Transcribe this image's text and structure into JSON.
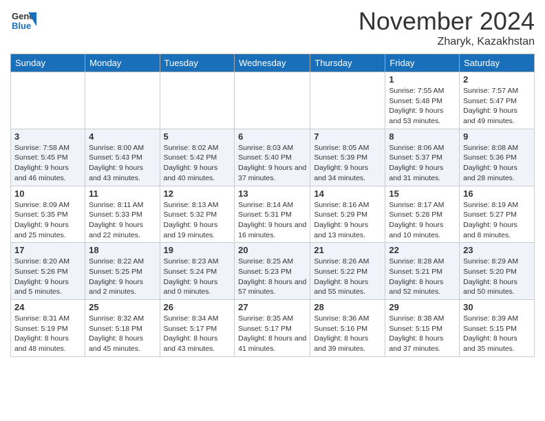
{
  "header": {
    "logo_general": "General",
    "logo_blue": "Blue",
    "month_title": "November 2024",
    "location": "Zharyk, Kazakhstan"
  },
  "days_of_week": [
    "Sunday",
    "Monday",
    "Tuesday",
    "Wednesday",
    "Thursday",
    "Friday",
    "Saturday"
  ],
  "weeks": [
    [
      {
        "day": "",
        "info": ""
      },
      {
        "day": "",
        "info": ""
      },
      {
        "day": "",
        "info": ""
      },
      {
        "day": "",
        "info": ""
      },
      {
        "day": "",
        "info": ""
      },
      {
        "day": "1",
        "info": "Sunrise: 7:55 AM\nSunset: 5:48 PM\nDaylight: 9 hours and 53 minutes."
      },
      {
        "day": "2",
        "info": "Sunrise: 7:57 AM\nSunset: 5:47 PM\nDaylight: 9 hours and 49 minutes."
      }
    ],
    [
      {
        "day": "3",
        "info": "Sunrise: 7:58 AM\nSunset: 5:45 PM\nDaylight: 9 hours and 46 minutes."
      },
      {
        "day": "4",
        "info": "Sunrise: 8:00 AM\nSunset: 5:43 PM\nDaylight: 9 hours and 43 minutes."
      },
      {
        "day": "5",
        "info": "Sunrise: 8:02 AM\nSunset: 5:42 PM\nDaylight: 9 hours and 40 minutes."
      },
      {
        "day": "6",
        "info": "Sunrise: 8:03 AM\nSunset: 5:40 PM\nDaylight: 9 hours and 37 minutes."
      },
      {
        "day": "7",
        "info": "Sunrise: 8:05 AM\nSunset: 5:39 PM\nDaylight: 9 hours and 34 minutes."
      },
      {
        "day": "8",
        "info": "Sunrise: 8:06 AM\nSunset: 5:37 PM\nDaylight: 9 hours and 31 minutes."
      },
      {
        "day": "9",
        "info": "Sunrise: 8:08 AM\nSunset: 5:36 PM\nDaylight: 9 hours and 28 minutes."
      }
    ],
    [
      {
        "day": "10",
        "info": "Sunrise: 8:09 AM\nSunset: 5:35 PM\nDaylight: 9 hours and 25 minutes."
      },
      {
        "day": "11",
        "info": "Sunrise: 8:11 AM\nSunset: 5:33 PM\nDaylight: 9 hours and 22 minutes."
      },
      {
        "day": "12",
        "info": "Sunrise: 8:13 AM\nSunset: 5:32 PM\nDaylight: 9 hours and 19 minutes."
      },
      {
        "day": "13",
        "info": "Sunrise: 8:14 AM\nSunset: 5:31 PM\nDaylight: 9 hours and 16 minutes."
      },
      {
        "day": "14",
        "info": "Sunrise: 8:16 AM\nSunset: 5:29 PM\nDaylight: 9 hours and 13 minutes."
      },
      {
        "day": "15",
        "info": "Sunrise: 8:17 AM\nSunset: 5:28 PM\nDaylight: 9 hours and 10 minutes."
      },
      {
        "day": "16",
        "info": "Sunrise: 8:19 AM\nSunset: 5:27 PM\nDaylight: 9 hours and 8 minutes."
      }
    ],
    [
      {
        "day": "17",
        "info": "Sunrise: 8:20 AM\nSunset: 5:26 PM\nDaylight: 9 hours and 5 minutes."
      },
      {
        "day": "18",
        "info": "Sunrise: 8:22 AM\nSunset: 5:25 PM\nDaylight: 9 hours and 2 minutes."
      },
      {
        "day": "19",
        "info": "Sunrise: 8:23 AM\nSunset: 5:24 PM\nDaylight: 9 hours and 0 minutes."
      },
      {
        "day": "20",
        "info": "Sunrise: 8:25 AM\nSunset: 5:23 PM\nDaylight: 8 hours and 57 minutes."
      },
      {
        "day": "21",
        "info": "Sunrise: 8:26 AM\nSunset: 5:22 PM\nDaylight: 8 hours and 55 minutes."
      },
      {
        "day": "22",
        "info": "Sunrise: 8:28 AM\nSunset: 5:21 PM\nDaylight: 8 hours and 52 minutes."
      },
      {
        "day": "23",
        "info": "Sunrise: 8:29 AM\nSunset: 5:20 PM\nDaylight: 8 hours and 50 minutes."
      }
    ],
    [
      {
        "day": "24",
        "info": "Sunrise: 8:31 AM\nSunset: 5:19 PM\nDaylight: 8 hours and 48 minutes."
      },
      {
        "day": "25",
        "info": "Sunrise: 8:32 AM\nSunset: 5:18 PM\nDaylight: 8 hours and 45 minutes."
      },
      {
        "day": "26",
        "info": "Sunrise: 8:34 AM\nSunset: 5:17 PM\nDaylight: 8 hours and 43 minutes."
      },
      {
        "day": "27",
        "info": "Sunrise: 8:35 AM\nSunset: 5:17 PM\nDaylight: 8 hours and 41 minutes."
      },
      {
        "day": "28",
        "info": "Sunrise: 8:36 AM\nSunset: 5:16 PM\nDaylight: 8 hours and 39 minutes."
      },
      {
        "day": "29",
        "info": "Sunrise: 8:38 AM\nSunset: 5:15 PM\nDaylight: 8 hours and 37 minutes."
      },
      {
        "day": "30",
        "info": "Sunrise: 8:39 AM\nSunset: 5:15 PM\nDaylight: 8 hours and 35 minutes."
      }
    ]
  ]
}
